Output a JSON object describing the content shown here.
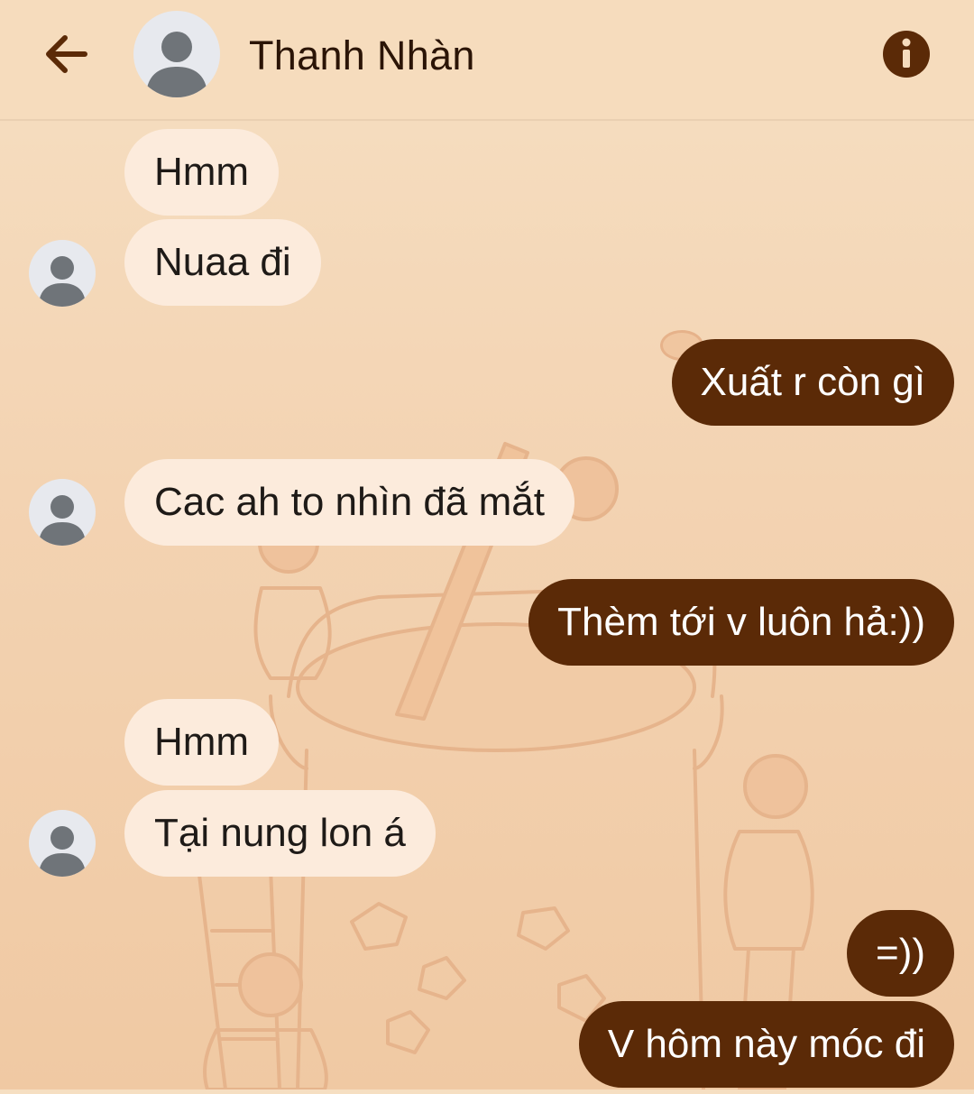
{
  "header": {
    "contact_name": "Thanh Nhàn",
    "icons": [
      "back-arrow-icon",
      "avatar-icon",
      "info-icon"
    ]
  },
  "colors": {
    "accent": "#5b2a07",
    "incoming_bubble": "#fcebdc",
    "header_bg": "#f6dcbd"
  },
  "messages": [
    {
      "sender": "contact",
      "text": "Hmm"
    },
    {
      "sender": "contact",
      "text": "Nuaa đi"
    },
    {
      "sender": "me",
      "text": "Xuất r còn gì"
    },
    {
      "sender": "contact",
      "text": "Cac ah to nhìn đã mắt"
    },
    {
      "sender": "me",
      "text": "Thèm tới v luôn hả:))"
    },
    {
      "sender": "contact",
      "text": "Hmm"
    },
    {
      "sender": "contact",
      "text": "Tại nung lon á"
    },
    {
      "sender": "me",
      "text": "=))"
    },
    {
      "sender": "me",
      "text": "V hôm này móc đi"
    }
  ]
}
